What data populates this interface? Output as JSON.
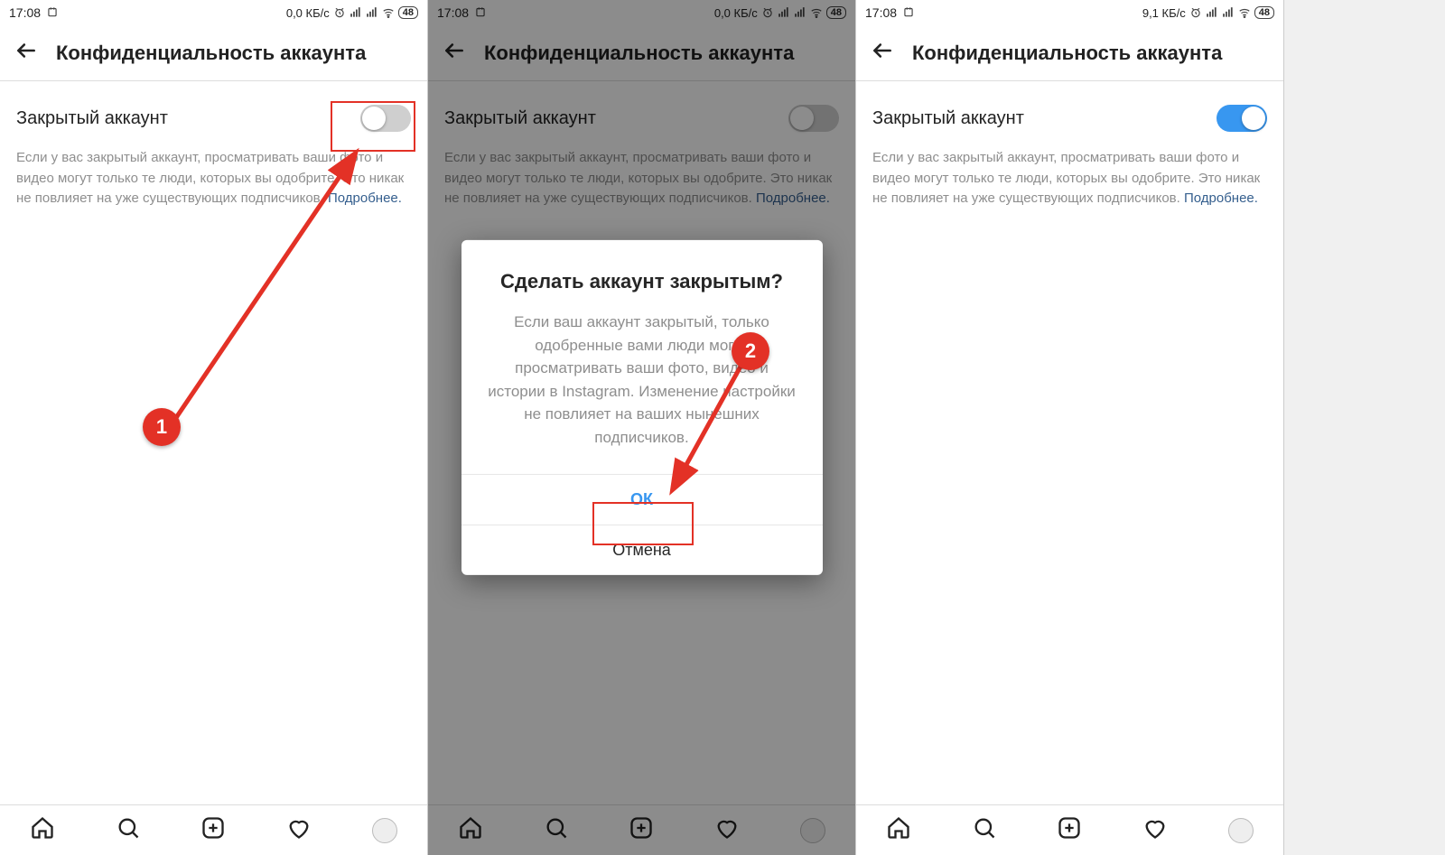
{
  "status": {
    "time": "17:08",
    "rate0": "0,0 КБ/с",
    "rate2": "9,1 КБ/с",
    "batt": "48"
  },
  "header": {
    "title": "Конфиденциальность аккаунта"
  },
  "setting": {
    "label": "Закрытый аккаунт",
    "desc": "Если у вас закрытый аккаунт, просматривать ваши фото и видео могут только те люди, которых вы одобрите. Это никак не повлияет на уже существующих подписчиков. ",
    "more": "Подробнее."
  },
  "dialog": {
    "title": "Сделать аккаунт закрытым?",
    "body": "Если ваш аккаунт закрытый, только одобренные вами люди могут просматривать ваши фото, видео и истории в Instagram. Изменение настройки не повлияет на ваших нынешних подписчиков.",
    "ok": "ОК",
    "cancel": "Отмена"
  },
  "steps": {
    "s1": "1",
    "s2": "2"
  }
}
